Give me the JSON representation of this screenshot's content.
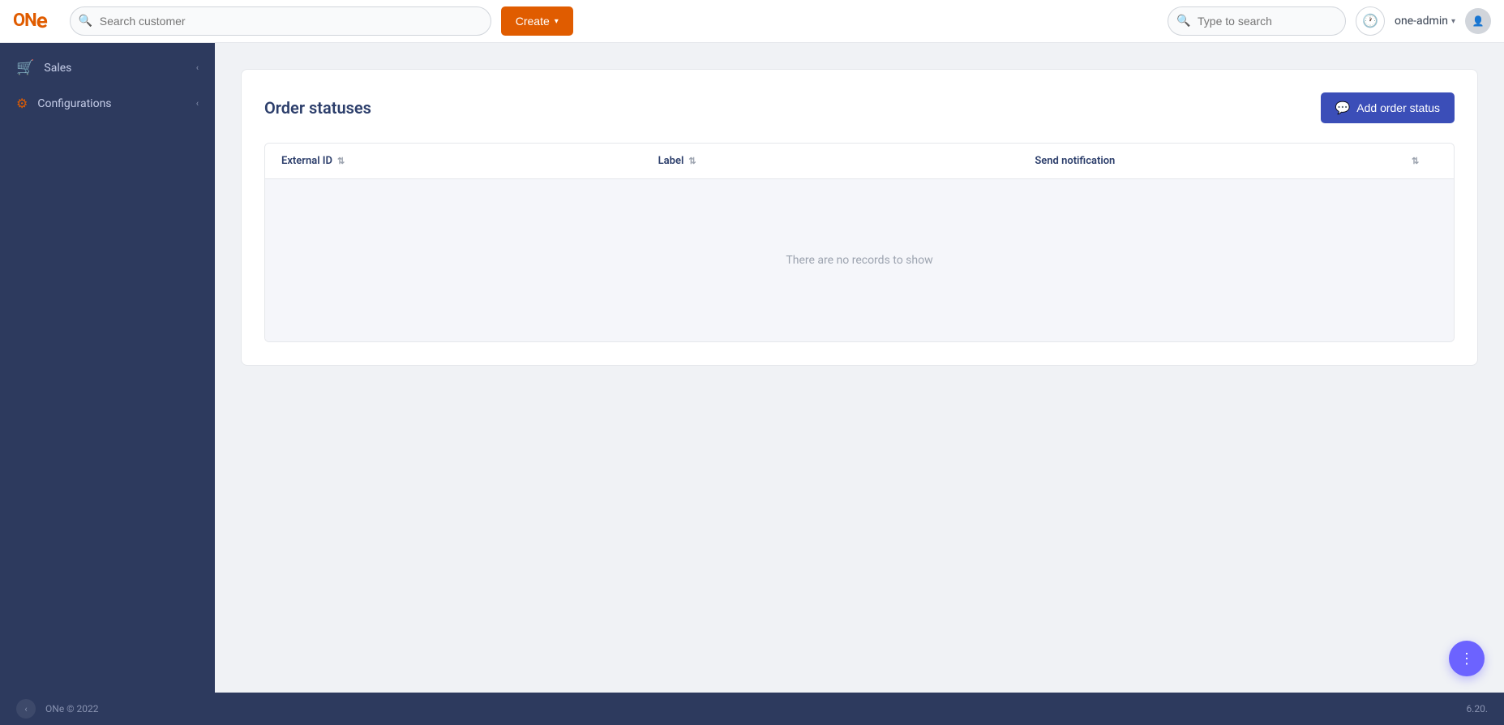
{
  "logo": {
    "text_on": "ON",
    "text_e": "e"
  },
  "topnav": {
    "search_customer_placeholder": "Search customer",
    "create_label": "Create",
    "global_search_placeholder": "Type to search",
    "user_name": "one-admin"
  },
  "sidebar": {
    "items": [
      {
        "id": "sales",
        "label": "Sales",
        "icon": "🛒"
      },
      {
        "id": "configurations",
        "label": "Configurations",
        "icon": "⚙"
      }
    ]
  },
  "main": {
    "card_title": "Order statuses",
    "add_button_label": "Add order status",
    "table": {
      "columns": [
        {
          "id": "external_id",
          "label": "External ID",
          "sortable": true
        },
        {
          "id": "label",
          "label": "Label",
          "sortable": true
        },
        {
          "id": "send_notification",
          "label": "Send notification",
          "sortable": true
        }
      ],
      "empty_message": "There are no records to show"
    }
  },
  "footer": {
    "copyright": "ONe © 2022",
    "version": "6.20."
  },
  "fab": {
    "icon": "⋮"
  }
}
